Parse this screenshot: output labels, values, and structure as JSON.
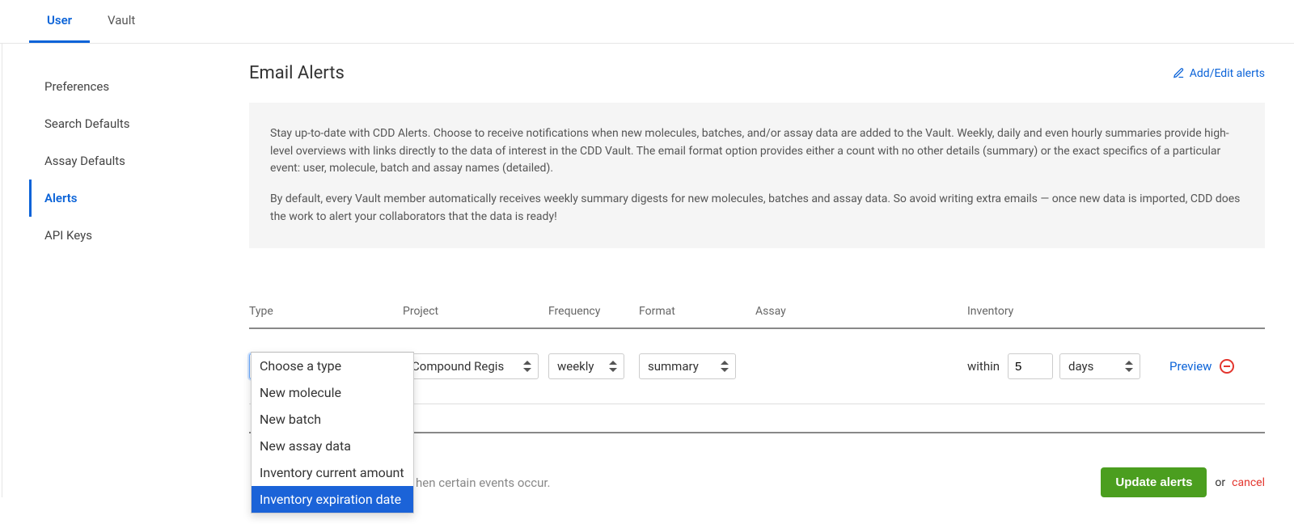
{
  "tabs": {
    "user": "User",
    "vault": "Vault"
  },
  "sidebar": {
    "items": [
      {
        "label": "Preferences"
      },
      {
        "label": "Search Defaults"
      },
      {
        "label": "Assay Defaults"
      },
      {
        "label": "Alerts"
      },
      {
        "label": "API Keys"
      }
    ],
    "active_index": 3
  },
  "page": {
    "title": "Email Alerts",
    "edit_link": "Add/Edit alerts"
  },
  "info": {
    "p1": "Stay up-to-date with CDD Alerts. Choose to receive notifications when new molecules, batches, and/or assay data are added to the Vault. Weekly, daily and even hourly summaries provide high-level overviews with links directly to the data of interest in the CDD Vault. The email format option provides either a count with no other details (summary) or the exact specifics of a particular event: user, molecule, batch and assay names (detailed).",
    "p2": "By default, every Vault member automatically receives weekly summary digests for new molecules, batches and assay data. So avoid writing extra emails — once new data is imported, CDD does the work to alert your collaborators that the data is ready!"
  },
  "columns": {
    "type": "Type",
    "project": "Project",
    "frequency": "Frequency",
    "format": "Format",
    "assay": "Assay",
    "inventory": "Inventory"
  },
  "row": {
    "type_display": "Inventory expirat",
    "project_display": "Compound Regis",
    "frequency": "weekly",
    "format": "summary",
    "within_label": "within",
    "within_value": "5",
    "within_unit": "days",
    "preview": "Preview"
  },
  "dropdown": {
    "items": [
      "Choose a type",
      "New molecule",
      "New batch",
      "New assay data",
      "Inventory current amount",
      "Inventory expiration date"
    ],
    "selected_index": 5
  },
  "footer": {
    "hint_fragment": "hen certain events occur.",
    "update": "Update alerts",
    "or": "or",
    "cancel": "cancel"
  }
}
